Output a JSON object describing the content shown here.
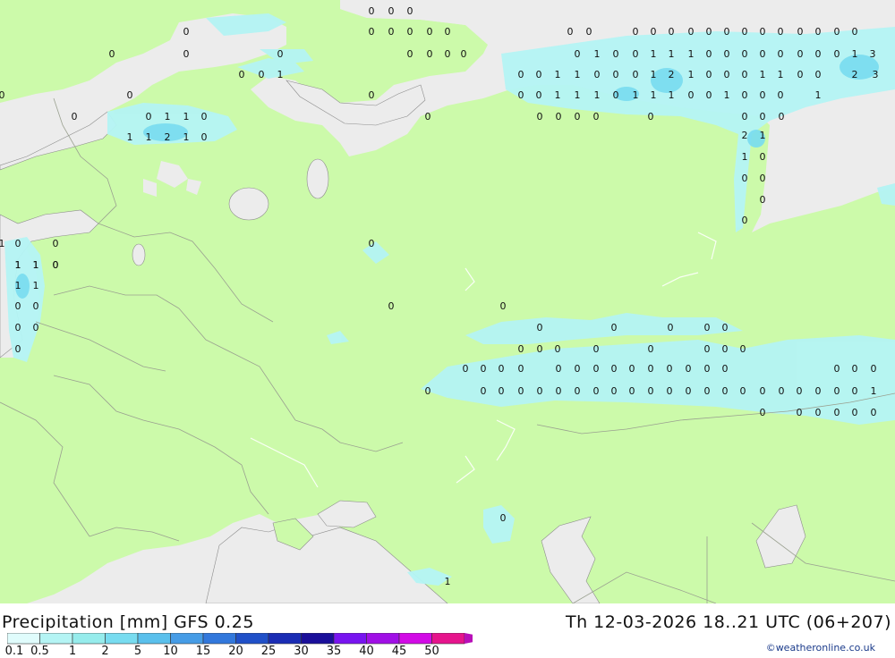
{
  "map": {
    "colors": {
      "land": "#ccfaaa",
      "sea": "#e6e6e6",
      "outside": "#ececec",
      "border": "#9aa090",
      "coast": "#8c8c8c"
    },
    "precip_values": [
      {
        "row": 1,
        "vals": [
          "0",
          "0",
          "0"
        ]
      },
      {
        "row": 2,
        "vals": [
          "0"
        ]
      },
      {
        "row": 3,
        "vals": [
          "0",
          "0",
          "0",
          "0",
          "0"
        ]
      },
      {
        "row": 4,
        "vals": [
          "0",
          "0",
          "0",
          "0",
          "0",
          "0",
          "0",
          "0",
          "0",
          "0",
          "0",
          "0",
          "0",
          "0",
          "0"
        ]
      },
      {
        "row": 5,
        "vals": [
          "0",
          "0"
        ]
      },
      {
        "row": 6,
        "vals": [
          "0",
          "0",
          "0",
          "0"
        ]
      },
      {
        "row": 7,
        "vals": [
          "0",
          "0",
          "1",
          "0",
          "0",
          "1",
          "1",
          "1",
          "0",
          "0",
          "0",
          "0",
          "0",
          "0",
          "0",
          "0",
          "1",
          "3"
        ]
      },
      {
        "row": 8,
        "vals": [
          "0",
          "0",
          "1"
        ]
      },
      {
        "row": 9,
        "vals": [
          "0",
          "0",
          "1",
          "1",
          "0",
          "0",
          "0",
          "1",
          "2",
          "1",
          "0",
          "0",
          "0",
          "1",
          "1",
          "0",
          "0",
          "2",
          "3"
        ]
      },
      {
        "row": 10,
        "vals": [
          "0",
          "0"
        ]
      },
      {
        "row": 11,
        "vals": [
          "0",
          "0",
          "0",
          "1",
          "1",
          "1",
          "0",
          "1",
          "1",
          "1",
          "0",
          "0",
          "1",
          "0",
          "0",
          "0",
          "1"
        ]
      },
      {
        "row": 12,
        "vals": [
          "0",
          "0",
          "1",
          "1",
          "0"
        ]
      },
      {
        "row": 13,
        "vals": [
          "0",
          "0",
          "0",
          "0",
          "0",
          "0",
          "0",
          "0"
        ]
      },
      {
        "row": 14,
        "vals": [
          "1",
          "1",
          "2",
          "1",
          "0"
        ]
      },
      {
        "row": 15,
        "vals": [
          "0",
          "2",
          "1",
          "1",
          "0",
          "0",
          "0",
          "0",
          "0"
        ]
      },
      {
        "row": 16,
        "vals": [
          "1",
          "0",
          "0",
          "0"
        ]
      },
      {
        "row": 17,
        "vals": [
          "1",
          "1",
          "0",
          "1",
          "1",
          "0",
          "1",
          "1",
          "0",
          "0",
          "0",
          "0",
          "0",
          "0",
          "0",
          "0",
          "0",
          "0",
          "0",
          "0",
          "0",
          "0",
          "0",
          "0",
          "0",
          "0",
          "0",
          "0"
        ]
      },
      {
        "row": 18,
        "vals": [
          "0",
          "0",
          "0",
          "0",
          "0",
          "0",
          "0",
          "0",
          "0",
          "0",
          "0",
          "0",
          "0",
          "0",
          "0",
          "0",
          "0",
          "0",
          "0",
          "0",
          "0",
          "0",
          "0",
          "0",
          "0",
          "0",
          "0",
          "0",
          "0",
          "0",
          "0",
          "0",
          "0",
          "0",
          "0",
          "0",
          "0",
          "0",
          "0",
          "1",
          "0",
          "0",
          "0",
          "0",
          "0",
          "0",
          "1",
          "0"
        ]
      }
    ]
  },
  "footer": {
    "title_left": "Precipitation [mm] GFS 0.25",
    "title_right": "Th 12-03-2026 18..21 UTC (06+207)",
    "credit": "©weatheronline.co.uk",
    "legend": [
      {
        "label": "0.1",
        "color": "#e0fcfc"
      },
      {
        "label": "0.5",
        "color": "#b4f4f4"
      },
      {
        "label": "1",
        "color": "#96ecec"
      },
      {
        "label": "2",
        "color": "#78dcf0"
      },
      {
        "label": "5",
        "color": "#5ac0ec"
      },
      {
        "label": "10",
        "color": "#469ce6"
      },
      {
        "label": "15",
        "color": "#3278dc"
      },
      {
        "label": "20",
        "color": "#2050c8"
      },
      {
        "label": "25",
        "color": "#1a2cb4"
      },
      {
        "label": "30",
        "color": "#1a0f9a"
      },
      {
        "label": "35",
        "color": "#7814f0"
      },
      {
        "label": "40",
        "color": "#a00fe6"
      },
      {
        "label": "45",
        "color": "#d20ae6"
      },
      {
        "label": "50",
        "color": "#e6148c"
      }
    ],
    "legend_end_color": "#b80fb8"
  }
}
